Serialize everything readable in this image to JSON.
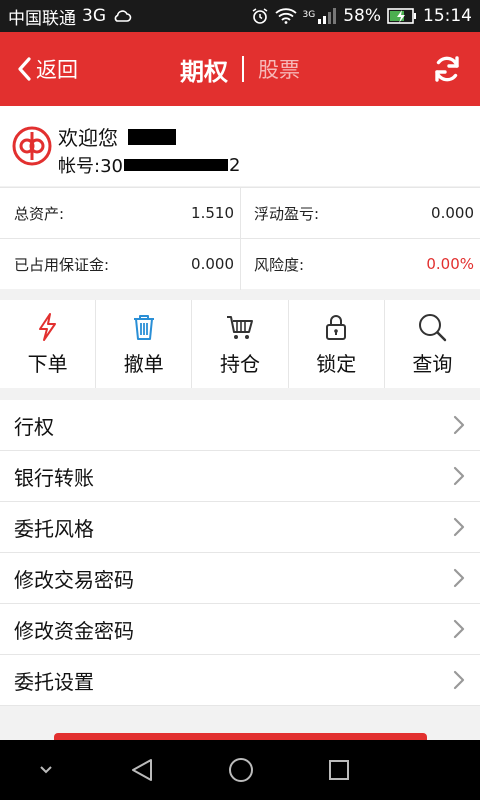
{
  "status_bar": {
    "carrier": "中国联通",
    "network": "3G",
    "signal_tag": "3G",
    "battery": "58%",
    "time": "15:14"
  },
  "header": {
    "back_label": "返回",
    "active_tab": "期权",
    "inactive_tab": "股票"
  },
  "user": {
    "welcome": "欢迎您",
    "account_prefix": "帐号:30",
    "account_suffix": "2"
  },
  "assets": {
    "total_label": "总资产:",
    "total_value": "1.510",
    "pnl_label": "浮动盈亏:",
    "pnl_value": "0.000",
    "margin_label": "已占用保证金:",
    "margin_value": "0.000",
    "risk_label": "风险度:",
    "risk_value": "0.00%"
  },
  "actions": [
    "下单",
    "撤单",
    "持仓",
    "锁定",
    "查询"
  ],
  "menu": [
    "行权",
    "银行转账",
    "委托风格",
    "修改交易密码",
    "修改资金密码",
    "委托设置"
  ],
  "colors": {
    "brand": "#e2302f",
    "icon_red": "#e2302f",
    "icon_blue": "#2a8fd6",
    "icon_dark": "#333333"
  }
}
